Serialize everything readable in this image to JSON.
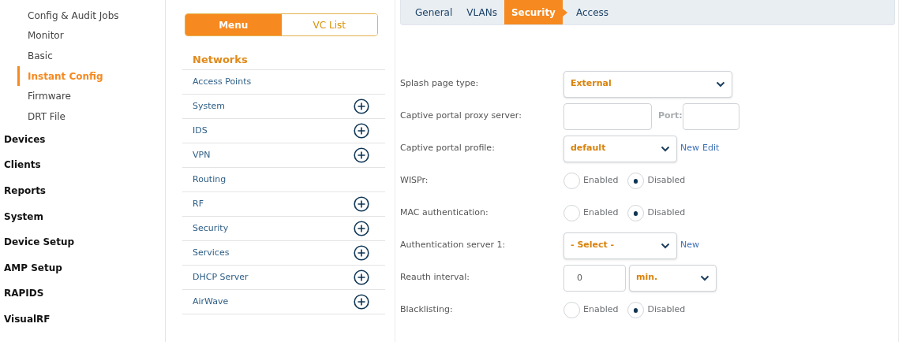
{
  "sidebar": {
    "items": [
      {
        "label": "Config & Audit Jobs",
        "kind": "sub",
        "selected": false
      },
      {
        "label": "Monitor",
        "kind": "sub",
        "selected": false
      },
      {
        "label": "Basic",
        "kind": "sub",
        "selected": false
      },
      {
        "label": "Instant Config",
        "kind": "sub",
        "selected": true
      },
      {
        "label": "Firmware",
        "kind": "sub",
        "selected": false
      },
      {
        "label": "DRT File",
        "kind": "sub",
        "selected": false
      },
      {
        "label": "Devices",
        "kind": "section",
        "selected": false
      },
      {
        "label": "Clients",
        "kind": "section",
        "selected": false
      },
      {
        "label": "Reports",
        "kind": "section",
        "selected": false
      },
      {
        "label": "System",
        "kind": "section",
        "selected": false
      },
      {
        "label": "Device Setup",
        "kind": "section",
        "selected": false
      },
      {
        "label": "AMP Setup",
        "kind": "section",
        "selected": false
      },
      {
        "label": "RAPIDS",
        "kind": "section",
        "selected": false
      },
      {
        "label": "VisualRF",
        "kind": "section",
        "selected": false
      }
    ]
  },
  "menu": {
    "toggle": [
      {
        "label": "Menu",
        "selected": true
      },
      {
        "label": "VC List",
        "selected": false
      }
    ],
    "heading": "Networks",
    "items": [
      {
        "label": "Access Points",
        "expandable": false
      },
      {
        "label": "System",
        "expandable": true
      },
      {
        "label": "IDS",
        "expandable": true
      },
      {
        "label": "VPN",
        "expandable": true
      },
      {
        "label": "Routing",
        "expandable": false
      },
      {
        "label": "RF",
        "expandable": true
      },
      {
        "label": "Security",
        "expandable": true
      },
      {
        "label": "Services",
        "expandable": true
      },
      {
        "label": "DHCP Server",
        "expandable": true
      },
      {
        "label": "AirWave",
        "expandable": true
      }
    ]
  },
  "tabs": [
    {
      "label": "General",
      "selected": false
    },
    {
      "label": "VLANs",
      "selected": false
    },
    {
      "label": "Security",
      "selected": true
    },
    {
      "label": "Access",
      "selected": false
    }
  ],
  "form": [
    {
      "kind": "select",
      "label": "Splash page type:",
      "value": "External"
    },
    {
      "kind": "proxy",
      "label": "Captive portal proxy server:",
      "port_label": "Port:"
    },
    {
      "kind": "select",
      "label": "Captive portal profile:",
      "value": "default",
      "links": [
        "New",
        "Edit"
      ]
    },
    {
      "kind": "radio",
      "label": "WISPr:",
      "options": [
        {
          "label": "Enabled",
          "selected": false
        },
        {
          "label": "Disabled",
          "selected": true
        }
      ]
    },
    {
      "kind": "radio",
      "label": "MAC authentication:",
      "options": [
        {
          "label": "Enabled",
          "selected": false
        },
        {
          "label": "Disabled",
          "selected": true
        }
      ]
    },
    {
      "kind": "select",
      "label": "Authentication server 1:",
      "value": "- Select -",
      "links": [
        "New"
      ]
    },
    {
      "kind": "interval",
      "label": "Reauth interval:",
      "value": "0",
      "unit": "min."
    },
    {
      "kind": "radio",
      "label": "Blacklisting:",
      "options": [
        {
          "label": "Enabled",
          "selected": false
        },
        {
          "label": "Disabled",
          "selected": true
        }
      ]
    }
  ]
}
